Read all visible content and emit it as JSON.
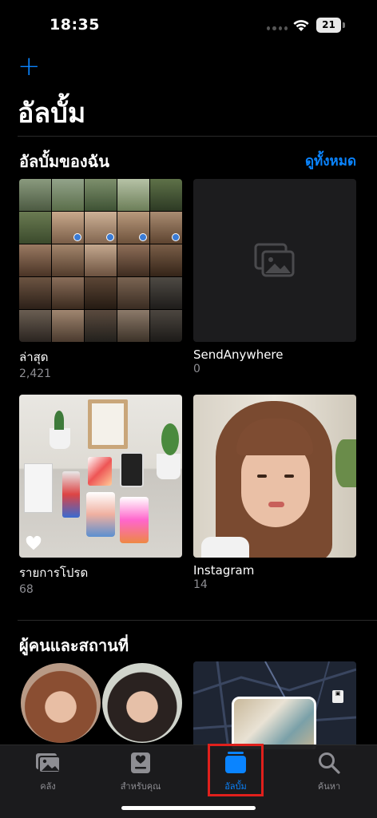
{
  "status_bar": {
    "time": "18:35",
    "battery": "21"
  },
  "header": {
    "title": "อัลบั้ม"
  },
  "my_albums": {
    "section_title": "อัลบั้มของฉัน",
    "see_all": "ดูทั้งหมด",
    "albums": [
      {
        "name": "ล่าสุด",
        "count": "2,421"
      },
      {
        "name": "SendAnywhere",
        "count": "0"
      },
      {
        "name": "รายการโปรด",
        "count": "68"
      },
      {
        "name": "Instagram",
        "count": "14"
      }
    ]
  },
  "people_places": {
    "section_title": "ผู้คนและสถานที่"
  },
  "tab_bar": {
    "tabs": [
      {
        "label": "คลัง",
        "icon": "photo-library-icon"
      },
      {
        "label": "สำหรับคุณ",
        "icon": "for-you-icon"
      },
      {
        "label": "อัลบั้ม",
        "icon": "albums-icon",
        "active": true
      },
      {
        "label": "ค้นหา",
        "icon": "search-icon"
      }
    ]
  },
  "colors": {
    "accent": "#0a84ff",
    "highlight": "#e0201c",
    "background": "#000000"
  }
}
